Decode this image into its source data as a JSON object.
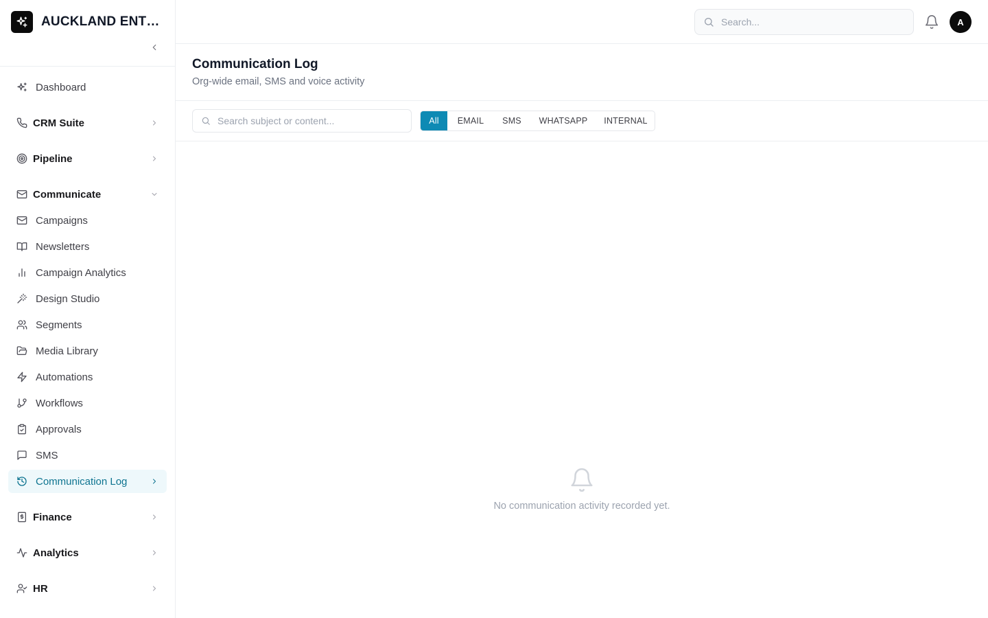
{
  "brand": {
    "name": "AUCKLAND ENTER...",
    "logo_icon": "sparkle-icon"
  },
  "sidebar": {
    "items": [
      {
        "label": "Dashboard",
        "icon": "sparkles-icon",
        "kind": "item"
      },
      {
        "label": "CRM Suite",
        "icon": "phone-icon",
        "kind": "section",
        "expanded": false
      },
      {
        "label": "Pipeline",
        "icon": "target-icon",
        "kind": "section",
        "expanded": false
      },
      {
        "label": "Communicate",
        "icon": "mail-icon",
        "kind": "section",
        "expanded": true
      },
      {
        "label": "Campaigns",
        "icon": "mail-icon",
        "kind": "item"
      },
      {
        "label": "Newsletters",
        "icon": "book-open-icon",
        "kind": "item"
      },
      {
        "label": "Campaign Analytics",
        "icon": "bar-chart-icon",
        "kind": "item"
      },
      {
        "label": "Design Studio",
        "icon": "magic-wand-icon",
        "kind": "item"
      },
      {
        "label": "Segments",
        "icon": "users-icon",
        "kind": "item"
      },
      {
        "label": "Media Library",
        "icon": "folder-open-icon",
        "kind": "item"
      },
      {
        "label": "Automations",
        "icon": "zap-icon",
        "kind": "item"
      },
      {
        "label": "Workflows",
        "icon": "git-branch-icon",
        "kind": "item"
      },
      {
        "label": "Approvals",
        "icon": "clipboard-check-icon",
        "kind": "item"
      },
      {
        "label": "SMS",
        "icon": "message-square-icon",
        "kind": "item"
      },
      {
        "label": "Communication Log",
        "icon": "history-icon",
        "kind": "item",
        "active": true
      },
      {
        "label": "Finance",
        "icon": "receipt-icon",
        "kind": "section",
        "expanded": false
      },
      {
        "label": "Analytics",
        "icon": "activity-icon",
        "kind": "section",
        "expanded": false
      },
      {
        "label": "HR",
        "icon": "user-check-icon",
        "kind": "section",
        "expanded": false
      }
    ]
  },
  "topbar": {
    "search_placeholder": "Search...",
    "avatar_initial": "A"
  },
  "page": {
    "title": "Communication Log",
    "subtitle": "Org-wide email, SMS and voice activity"
  },
  "filters": {
    "search_placeholder": "Search subject or content...",
    "tabs": [
      "All",
      "EMAIL",
      "SMS",
      "WHATSAPP",
      "INTERNAL"
    ],
    "selected": "All"
  },
  "empty_state": {
    "text": "No communication activity recorded yet.",
    "icon": "bell-icon"
  },
  "colors": {
    "accent": "#0e8ab4",
    "active_nav_bg": "#eef8fb",
    "active_nav_text": "#0e7490"
  }
}
